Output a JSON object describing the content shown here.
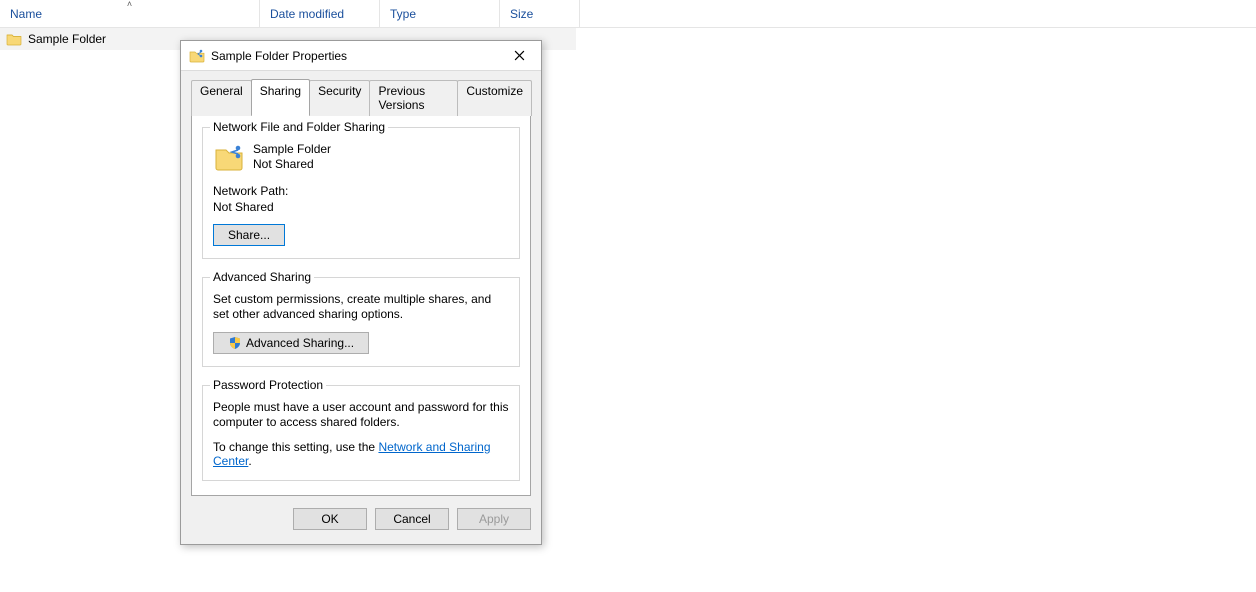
{
  "explorer": {
    "columns": {
      "name": "Name",
      "date": "Date modified",
      "type": "Type",
      "size": "Size"
    },
    "row": {
      "name": "Sample Folder"
    }
  },
  "dialog": {
    "title": "Sample Folder Properties",
    "tabs": {
      "general": "General",
      "sharing": "Sharing",
      "security": "Security",
      "previous": "Previous Versions",
      "customize": "Customize"
    },
    "network_group": {
      "legend": "Network File and Folder Sharing",
      "folder_name": "Sample Folder",
      "share_state": "Not Shared",
      "path_label": "Network Path:",
      "path_value": "Not Shared",
      "share_btn": "Share..."
    },
    "advanced_group": {
      "legend": "Advanced Sharing",
      "desc": "Set custom permissions, create multiple shares, and set other advanced sharing options.",
      "btn": "Advanced Sharing..."
    },
    "password_group": {
      "legend": "Password Protection",
      "desc": "People must have a user account and password for this computer to access shared folders.",
      "change_prefix": "To change this setting, use the ",
      "link": "Network and Sharing Center",
      "period": "."
    },
    "buttons": {
      "ok": "OK",
      "cancel": "Cancel",
      "apply": "Apply"
    }
  }
}
